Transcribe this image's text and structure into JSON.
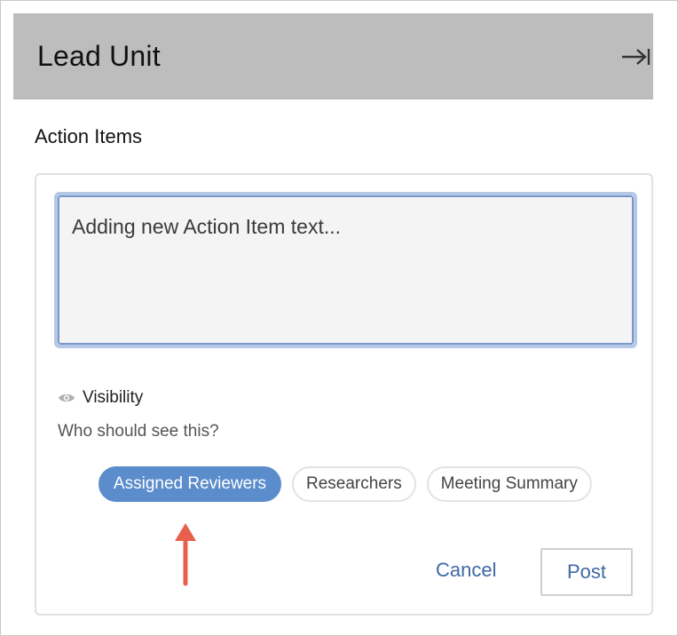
{
  "header": {
    "title": "Lead Unit",
    "collapse_icon": "collapse-right-icon"
  },
  "section": {
    "title": "Action Items"
  },
  "editor": {
    "text": "Adding new Action Item text..."
  },
  "visibility": {
    "label": "Visibility",
    "question": "Who should see this?",
    "options": [
      {
        "label": "Assigned Reviewers",
        "selected": true
      },
      {
        "label": "Researchers",
        "selected": false
      },
      {
        "label": "Meeting Summary",
        "selected": false
      }
    ]
  },
  "actions": {
    "cancel_label": "Cancel",
    "post_label": "Post"
  },
  "colors": {
    "header_bg": "#bdbdbd",
    "accent": "#5b8ccb",
    "link": "#3f69a3",
    "arrow": "#e8604c"
  }
}
